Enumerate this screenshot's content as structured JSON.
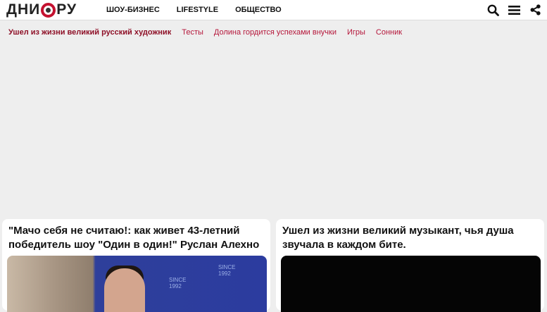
{
  "header": {
    "logo": {
      "left": "ДНИ",
      "right": "РУ"
    },
    "nav": [
      "ШОУ-БИЗНЕС",
      "LIFESTYLE",
      "ОБЩЕСТВО"
    ],
    "icons": [
      "search-icon",
      "menu-icon",
      "share-icon"
    ]
  },
  "subnav": [
    "Ушел из жизни великий русский художник",
    "Тесты",
    "Долина гордится успехами внучки",
    "Игры",
    "Сонник"
  ],
  "cards": [
    {
      "title": "\"Мачо себя не считаю!: как живет 43-летний победитель шоу \"Один в один!\" Руслан Алехно",
      "badge_1": "SINCE\n1992",
      "badge_2": "SINCE\n1992"
    },
    {
      "title": "Ушел из жизни великий музыкант, чья душа звучала в каждом бите."
    }
  ],
  "colors": {
    "accent": "#b5163a",
    "accent_dark": "#8e1027",
    "logo_ring": "#c41230"
  }
}
